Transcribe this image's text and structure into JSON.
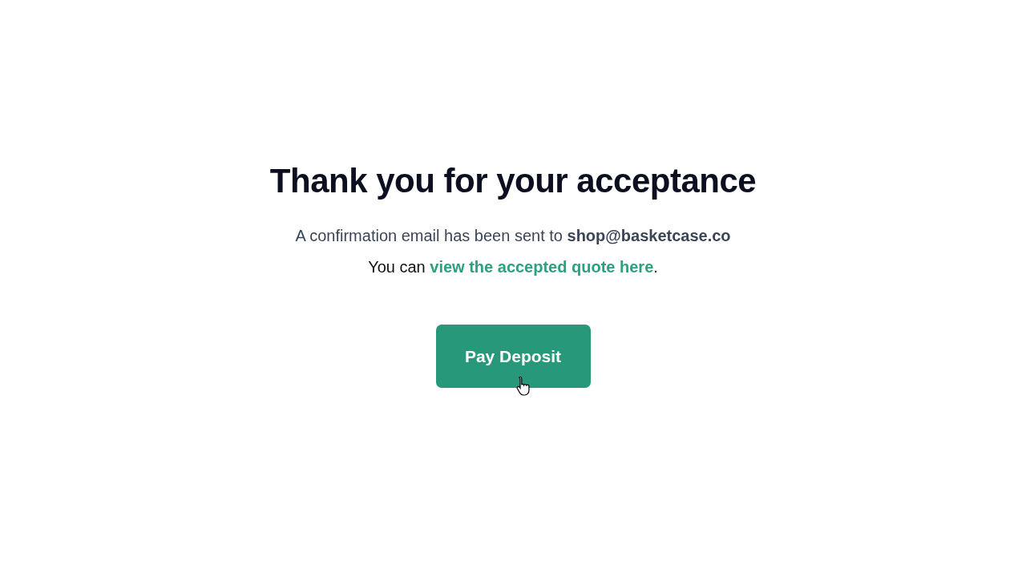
{
  "heading": "Thank you for your acceptance",
  "confirmation": "A confirmation email has been sent to **shop@basketcase.co**",
  "quote_line": {
    "before": "You can ",
    "link": "view the accepted quote here",
    "after": "."
  },
  "button": {
    "label": "Pay Deposit"
  }
}
